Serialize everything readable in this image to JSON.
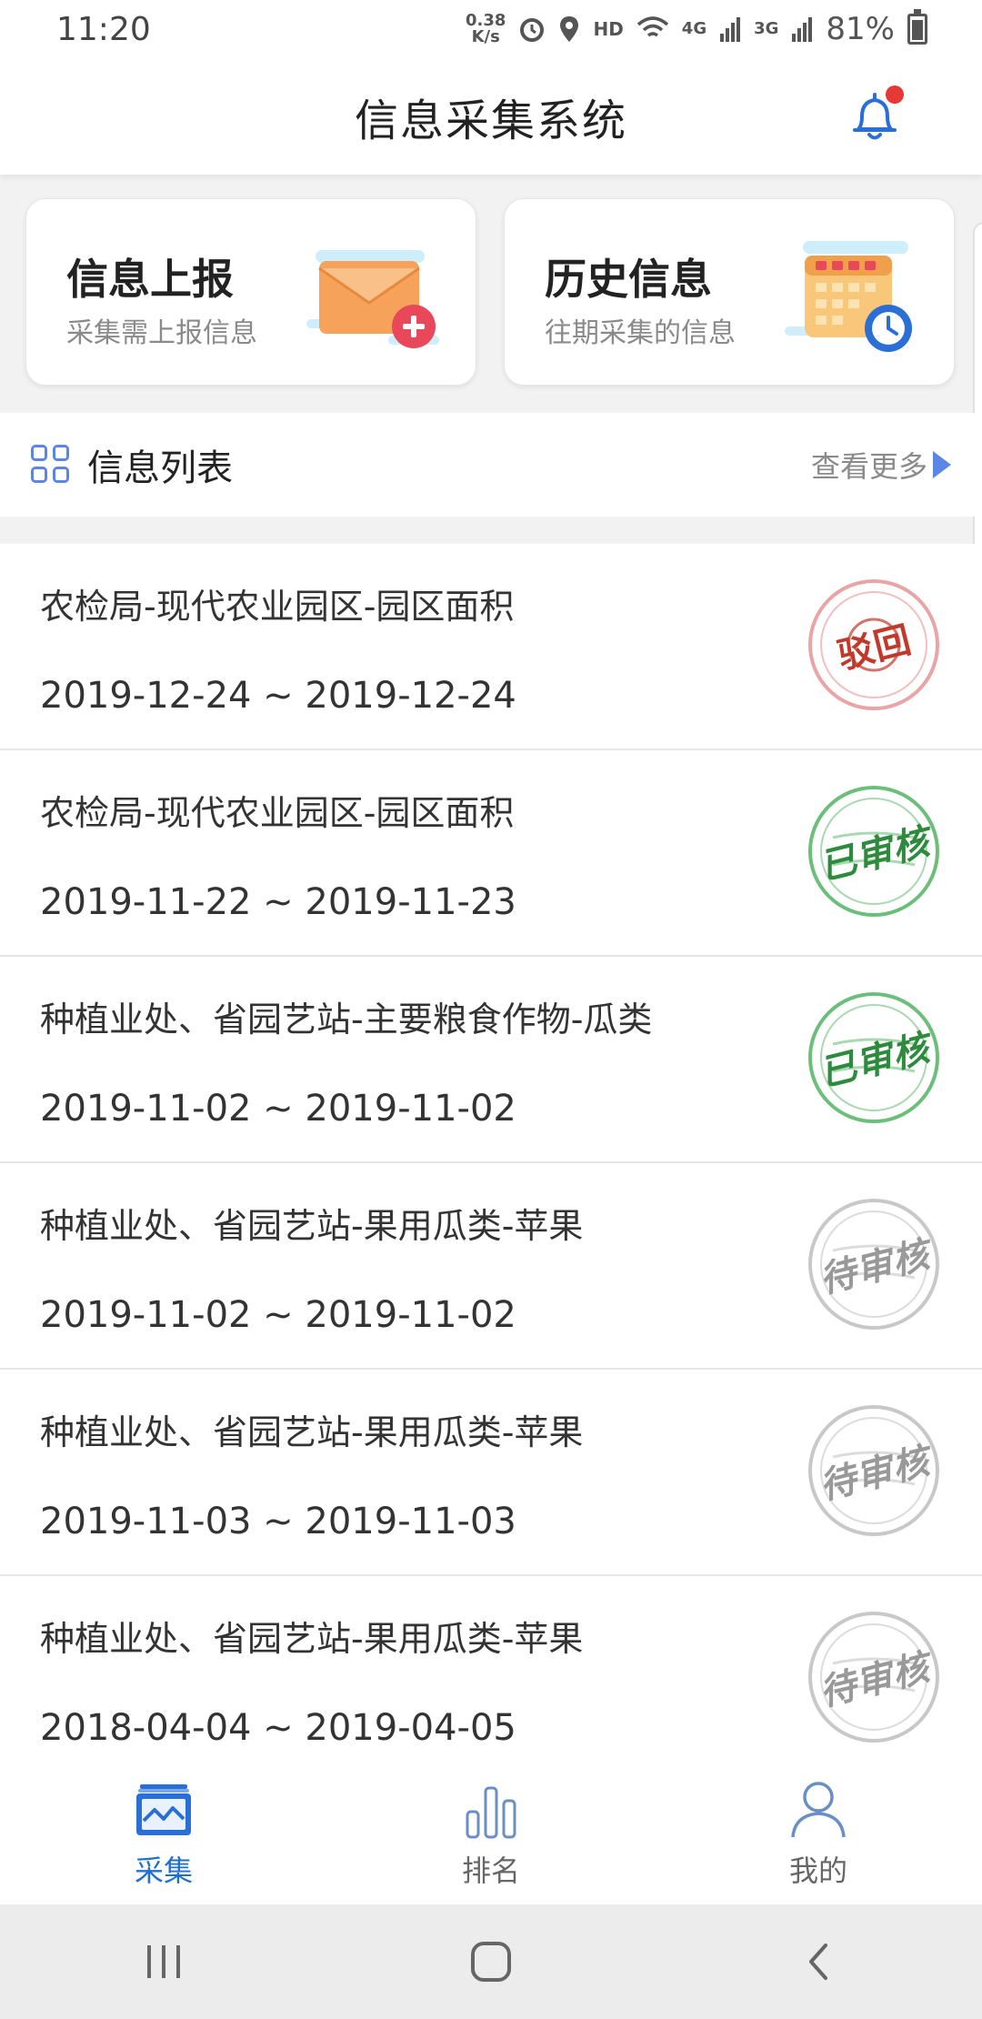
{
  "status_bar": {
    "time": "11:20",
    "net_speed_value": "0.38",
    "net_speed_unit": "K/s",
    "hd": "HD",
    "signal_4g": "4G",
    "signal_3g": "3G",
    "battery": "81%"
  },
  "header": {
    "title": "信息采集系统",
    "has_notification": true
  },
  "cards": [
    {
      "title": "信息上报",
      "subtitle": "采集需上报信息",
      "icon": "envelope-plus-icon"
    },
    {
      "title": "历史信息",
      "subtitle": "往期采集的信息",
      "icon": "calendar-clock-icon"
    }
  ],
  "list": {
    "title": "信息列表",
    "more_label": "查看更多",
    "items": [
      {
        "title": "农检局-现代农业园区-园区面积",
        "dates": "2019-12-24 ~ 2019-12-24",
        "status": "驳回",
        "status_type": "rejected"
      },
      {
        "title": "农检局-现代农业园区-园区面积",
        "dates": "2019-11-22 ~ 2019-11-23",
        "status": "已审核",
        "status_type": "approved"
      },
      {
        "title": "种植业处、省园艺站-主要粮食作物-瓜类",
        "dates": "2019-11-02 ~ 2019-11-02",
        "status": "已审核",
        "status_type": "approved"
      },
      {
        "title": "种植业处、省园艺站-果用瓜类-苹果",
        "dates": "2019-11-02 ~ 2019-11-02",
        "status": "待审核",
        "status_type": "pending"
      },
      {
        "title": "种植业处、省园艺站-果用瓜类-苹果",
        "dates": "2019-11-03 ~ 2019-11-03",
        "status": "待审核",
        "status_type": "pending"
      },
      {
        "title": "种植业处、省园艺站-果用瓜类-苹果",
        "dates": "2018-04-04 ~ 2019-04-05",
        "status": "待审核",
        "status_type": "pending"
      }
    ]
  },
  "tabs": [
    {
      "label": "采集",
      "icon": "collect-icon",
      "active": true
    },
    {
      "label": "排名",
      "icon": "bar-chart-icon",
      "active": false
    },
    {
      "label": "我的",
      "icon": "user-icon",
      "active": false
    }
  ],
  "colors": {
    "accent": "#1f6fd1",
    "stamp_rejected": "#c0392b",
    "stamp_approved": "#2e8b3e",
    "stamp_pending": "#999999"
  }
}
